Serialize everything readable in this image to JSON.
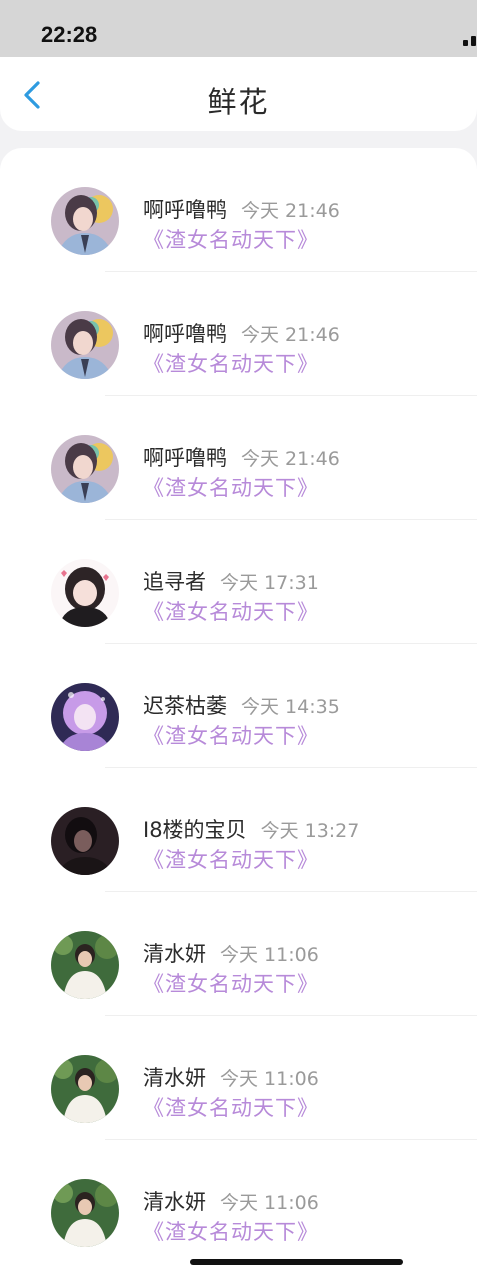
{
  "status_bar": {
    "time": "22:28"
  },
  "nav": {
    "title": "鲜花"
  },
  "items": [
    {
      "name": "啊呼噜鸭",
      "time": "今天 21:46",
      "book": "《渣女名动天下》",
      "avatar": "avatar-a"
    },
    {
      "name": "啊呼噜鸭",
      "time": "今天 21:46",
      "book": "《渣女名动天下》",
      "avatar": "avatar-a"
    },
    {
      "name": "啊呼噜鸭",
      "time": "今天 21:46",
      "book": "《渣女名动天下》",
      "avatar": "avatar-a"
    },
    {
      "name": "追寻者",
      "time": "今天 17:31",
      "book": "《渣女名动天下》",
      "avatar": "avatar-b"
    },
    {
      "name": "迟茶枯萎",
      "time": "今天 14:35",
      "book": "《渣女名动天下》",
      "avatar": "avatar-c"
    },
    {
      "name": "I8楼的宝贝",
      "time": "今天 13:27",
      "book": "《渣女名动天下》",
      "avatar": "avatar-d"
    },
    {
      "name": "清水妍",
      "time": "今天 11:06",
      "book": "《渣女名动天下》",
      "avatar": "avatar-e"
    },
    {
      "name": "清水妍",
      "time": "今天 11:06",
      "book": "《渣女名动天下》",
      "avatar": "avatar-e"
    },
    {
      "name": "清水妍",
      "time": "今天 11:06",
      "book": "《渣女名动天下》",
      "avatar": "avatar-e"
    }
  ],
  "colors": {
    "accent": "#2e9be0",
    "book_link": "#b78ad9",
    "status_bar_bg": "#d6d6d6",
    "page_bg": "#f2f2f4"
  }
}
